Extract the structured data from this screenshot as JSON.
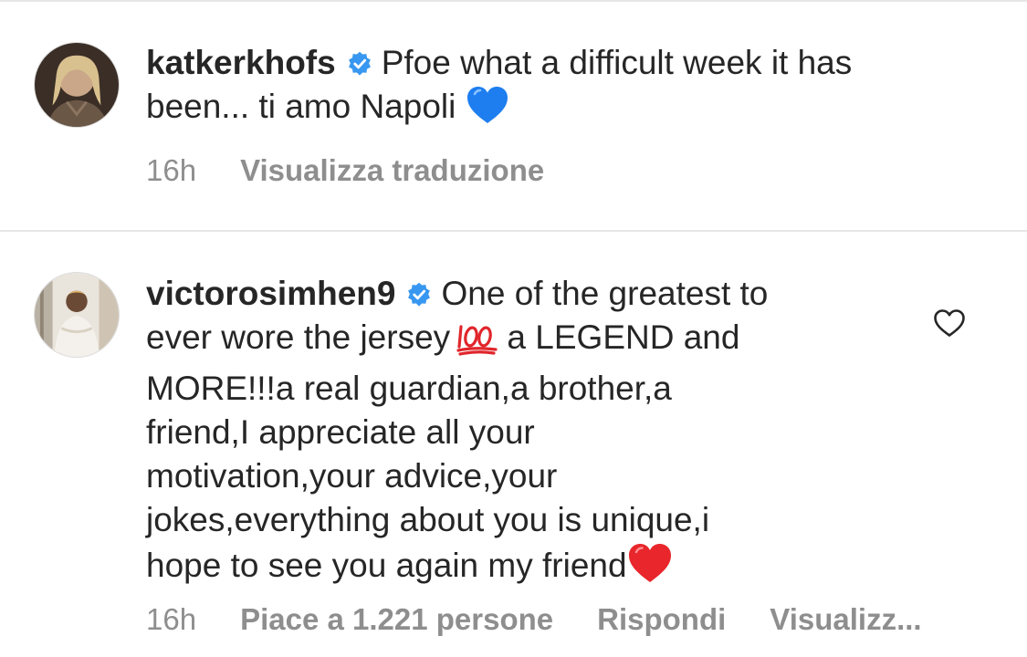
{
  "comments": [
    {
      "username": "katkerkhofs",
      "verified": true,
      "avatar_icon": "profile-photo-woman",
      "line1_text": "Pfoe what a difficult week it has",
      "line2_text": "been... ti amo Napoli ",
      "line2_emoji": "blue-heart",
      "time": "16h",
      "action_translate": "Visualizza traduzione"
    },
    {
      "username": "victorosimhen9",
      "verified": true,
      "avatar_icon": "profile-photo-person",
      "first_line_text": "One of the greatest to",
      "line2_text": "ever wore the jersey",
      "line2_emoji": "hundred-points",
      "line2_tail": " a LEGEND and",
      "lines": [
        "MORE!!!a real guardian,a brother,a",
        "friend,I appreciate all your",
        "motivation,your advice,your",
        "jokes,everything about you is unique,i"
      ],
      "last_line_text": "hope to see you again my friend",
      "last_line_emoji": "red-heart",
      "time": "16h",
      "action_likes": "Piace a 1.221 persone",
      "action_reply": "Rispondi",
      "action_translate": "Visualizz..."
    }
  ],
  "colors": {
    "text": "#262626",
    "secondary": "#8e8e8e",
    "verified_blue": "#3897f0",
    "divider": "#e6e6e6"
  },
  "icons": {
    "like": "heart-outline-icon",
    "verified": "verified-badge-icon"
  }
}
